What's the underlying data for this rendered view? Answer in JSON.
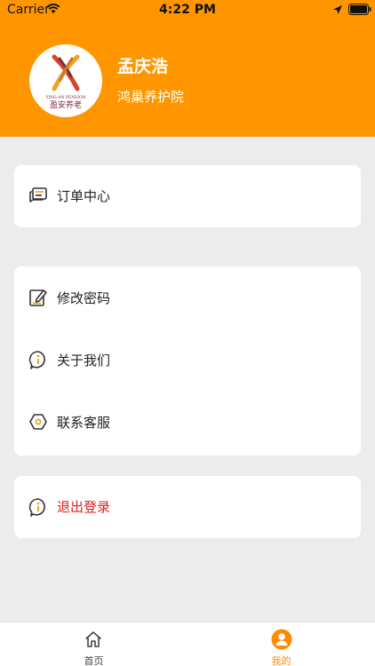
{
  "status_bar": {
    "carrier": "Carrier",
    "time": "4:22 PM"
  },
  "profile": {
    "name": "孟庆浩",
    "organization": "鸿巢养护院",
    "avatar_logo_text": "YING-AN PENSION 盈安养老"
  },
  "menu": {
    "orders": {
      "label": "订单中心",
      "icon": "message-list-icon"
    },
    "change_password": {
      "label": "修改密码",
      "icon": "edit-icon"
    },
    "about_us": {
      "label": "关于我们",
      "icon": "info-icon"
    },
    "contact_service": {
      "label": "联系客服",
      "icon": "hexagon-icon"
    },
    "logout": {
      "label": "退出登录",
      "icon": "info-icon"
    }
  },
  "tabbar": {
    "home": "首页",
    "mine": "我的"
  },
  "colors": {
    "brand": "#ff9600",
    "logout_text": "#e02020",
    "background": "#ececec"
  }
}
